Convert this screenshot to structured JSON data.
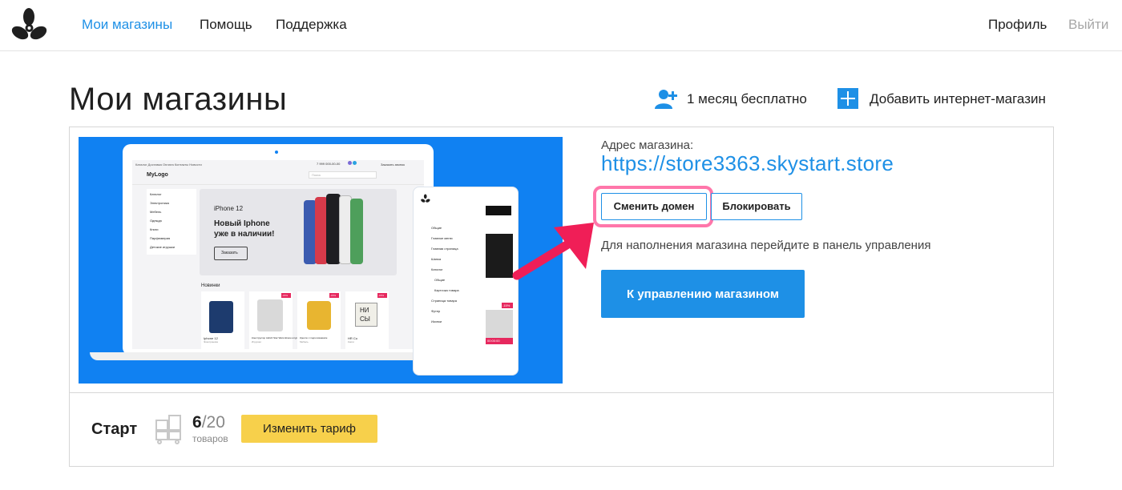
{
  "colors": {
    "accent": "#1e90e6",
    "highlight": "#ff5e9b",
    "arrow": "#f01e57",
    "tariff_button": "#f7d04b",
    "preview_bg": "#1081f2"
  },
  "nav": {
    "logo": "propeller-logo-icon",
    "links": [
      "Мои магазины",
      "Помощь",
      "Поддержка"
    ],
    "active": "Мои магазины",
    "profile": "Профиль",
    "logout": "Выйти"
  },
  "page": {
    "title": "Мои магазины",
    "actions": [
      {
        "icon": "add-user-icon",
        "label": "1 месяц бесплатно"
      },
      {
        "icon": "plus-square-icon",
        "label": "Добавить интернет-магазин"
      }
    ]
  },
  "store": {
    "address_label": "Адрес магазина:",
    "address": "https://store3363.skystart.store",
    "change_domain_label": "Сменить домен",
    "block_label": "Блокировать",
    "hint": "Для наполнения магазина перейдите в панель управления",
    "manage_label": "К управлению магазином"
  },
  "plan": {
    "name": "Старт",
    "icon": "boxes-icon",
    "used": "6",
    "total": "/20",
    "unit": "товаров",
    "change_label": "Изменить тариф"
  },
  "preview": {
    "logo": "MyLogo",
    "topnav": "Каталог  Доставка  Оплата  Контакты  Новости",
    "phone_number": "7 999 000-00-00",
    "callback": "Заказать звонок",
    "search_placeholder": "Поиск",
    "categories": [
      "Каталог",
      "Электроника",
      "Мебель",
      "Одежда",
      "Книги",
      "Парфюмерия",
      "Детские игрушки"
    ],
    "banner_brand": "iPhone 12",
    "banner_title_line1": "Новый Iphone",
    "banner_title_line2": "уже в наличии!",
    "banner_button": "Заказать",
    "new_section": "Новинки",
    "products": [
      "Iphone 12",
      "Конструктор LEGO Star Wars Шлем штурмовика 75276",
      "Кресло с подголовником",
      "HR Со"
    ],
    "product_subs": [
      "Электроника",
      "Игрушки",
      "Мебель",
      "Книги"
    ],
    "sale_badges": [
      "-15%",
      "-15%",
      "-15%"
    ],
    "phone_menu": [
      "Общие",
      "Главное меню",
      "Главная страница",
      "Шапка",
      "Каталог",
      "Общие",
      "Карточка товара",
      "Страница товара",
      "Футер",
      "Иконки"
    ],
    "phone_badge": "-15%",
    "phone_timer": "00:00:00",
    "book_text_1": "НИ",
    "book_text_2": "СЫ"
  }
}
